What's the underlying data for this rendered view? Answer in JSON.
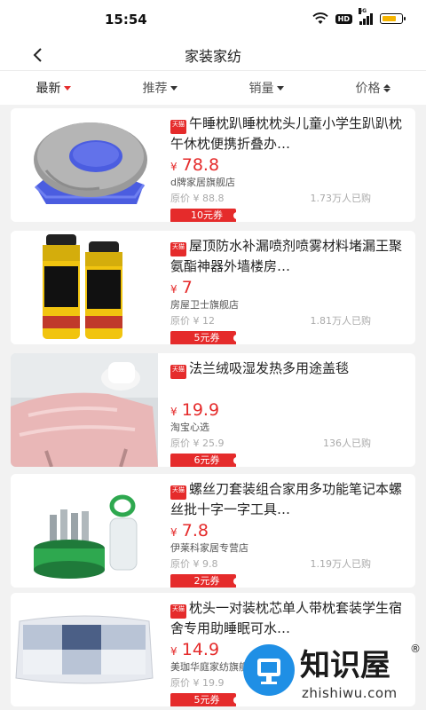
{
  "status": {
    "time": "15:54",
    "hd_label": "HD",
    "signal_label": "5G",
    "battery_level": 0.75
  },
  "nav": {
    "title": "家装家纺",
    "back_icon": "chevron-left-icon"
  },
  "filters": [
    {
      "label": "最新",
      "icon": "caret-down-icon",
      "active": true
    },
    {
      "label": "推荐",
      "icon": "caret-down-icon"
    },
    {
      "label": "销量",
      "icon": "caret-down-icon"
    },
    {
      "label": "价格",
      "icon": "sort-icon"
    }
  ],
  "products": [
    {
      "badge": "天猫",
      "title": "午睡枕趴睡枕枕头儿童小学生趴趴枕午休枕便携折叠办…",
      "currency": "¥",
      "price": "78.8",
      "shop": "d牌家居旗舰店",
      "original": "原价 ¥ 88.8",
      "sold": "1.73万人已购",
      "coupon": "10元券"
    },
    {
      "badge": "天猫",
      "title": "屋顶防水补漏喷剂喷雾材料堵漏王聚氨酯神器外墙楼房…",
      "currency": "¥",
      "price": "7",
      "shop": "房屋卫士旗舰店",
      "original": "原价 ¥ 12",
      "sold": "1.81万人已购",
      "coupon": "5元券"
    },
    {
      "badge": "天猫",
      "title": "法兰绒吸湿发热多用途盖毯",
      "currency": "¥",
      "price": "19.9",
      "shop": "淘宝心选",
      "original": "原价 ¥ 25.9",
      "sold": "136人已购",
      "coupon": "6元券"
    },
    {
      "badge": "天猫",
      "title": "螺丝刀套装组合家用多功能笔记本螺丝批十字一字工具…",
      "currency": "¥",
      "price": "7.8",
      "shop": "伊莱科家居专营店",
      "original": "原价 ¥ 9.8",
      "sold": "1.19万人已购",
      "coupon": "2元券"
    },
    {
      "badge": "天猫",
      "title": "枕头一对装枕芯单人带枕套装学生宿舍专用助睡眠可水…",
      "currency": "¥",
      "price": "14.9",
      "shop": "美珈华庭家纺旗舰店",
      "original": "原价 ¥ 19.9",
      "sold": "",
      "coupon": "5元券"
    }
  ],
  "watermark": {
    "text": "知识屋",
    "url": "zhishiwu.com",
    "reg": "®"
  },
  "colors": {
    "accent": "#e52b2b",
    "watermark_blue": "#1f8fe5"
  }
}
